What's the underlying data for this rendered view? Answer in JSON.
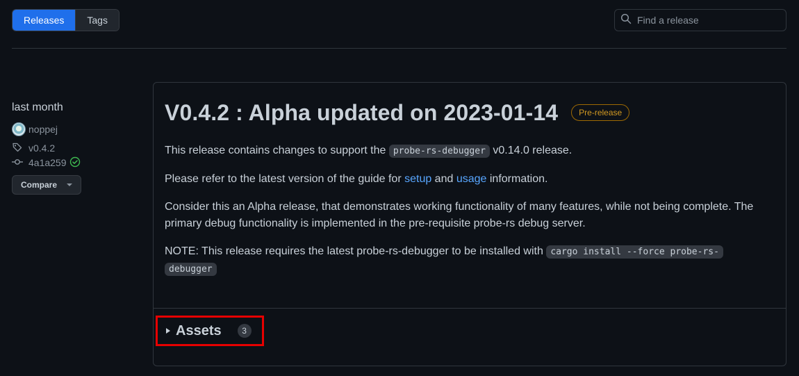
{
  "tabs": [
    {
      "label": "Releases",
      "active": true
    },
    {
      "label": "Tags",
      "active": false
    }
  ],
  "search": {
    "placeholder": "Find a release",
    "icon": "search-icon"
  },
  "sidebar": {
    "when": "last month",
    "author": "noppej",
    "tag": "v0.4.2",
    "commit": "4a1a259",
    "compare_label": "Compare"
  },
  "release": {
    "title": "V0.4.2 : Alpha updated on 2023-01-14",
    "badge": "Pre-release",
    "p1": {
      "before": "This release contains changes to support the ",
      "code": "probe-rs-debugger",
      "after": " v0.14.0 release."
    },
    "p2": {
      "before": "Please refer to the latest version of the guide for ",
      "link1": "setup",
      "mid": " and ",
      "link2": "usage",
      "after": " information."
    },
    "p3": "Consider this an Alpha release, that demonstrates working functionality of many features, while not being complete. The primary debug functionality is implemented in the pre-requisite probe-rs debug server.",
    "p4": {
      "before": "NOTE: This release requires the latest probe-rs-debugger to be installed with ",
      "code1": "cargo install --force  probe-rs-",
      "code2": "debugger"
    }
  },
  "assets": {
    "label": "Assets",
    "count": "3"
  },
  "colors": {
    "accent": "#1f6feb",
    "link": "#58a6ff",
    "prerelease": "#d29922",
    "highlight": "#e60000",
    "success": "#3fb950"
  }
}
